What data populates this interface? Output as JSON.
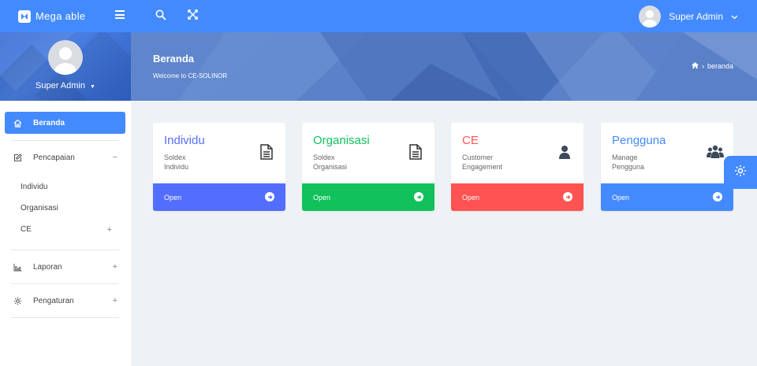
{
  "app": {
    "logo_text": "Mega able"
  },
  "topbar": {
    "user_name": "Super Admin"
  },
  "sidebar": {
    "user_name": "Super Admin",
    "items": [
      {
        "label": "Beranda",
        "icon": "home-icon",
        "active": true
      },
      {
        "label": "Pencapaian",
        "icon": "edit-icon",
        "toggle": "−"
      },
      {
        "label": "Laporan",
        "icon": "bar-chart-icon",
        "toggle": "+"
      },
      {
        "label": "Pengaturan",
        "icon": "gear-icon",
        "toggle": "+"
      }
    ],
    "sub_items": [
      {
        "label": "Individu"
      },
      {
        "label": "Organisasi"
      },
      {
        "label": "CE",
        "toggle": "+"
      }
    ]
  },
  "banner": {
    "title": "Beranda",
    "subtitle": "Welcome to CE-SOLINOR",
    "breadcrumb": "beranda"
  },
  "cards": [
    {
      "title": "Individu",
      "desc": "Soldex\nIndividu",
      "link": "Open",
      "color": "#536dfe",
      "title_color": "#536dfe",
      "icon": "document-icon"
    },
    {
      "title": "Organisasi",
      "desc": "Soldex\nOrganisasi",
      "link": "Open",
      "color": "#11c15b",
      "title_color": "#11c15b",
      "icon": "document-icon"
    },
    {
      "title": "CE",
      "desc": "Customer\nEngagement",
      "link": "Open",
      "color": "#ff5252",
      "title_color": "#ff5252",
      "icon": "user-icon"
    },
    {
      "title": "Pengguna",
      "desc": "Manage\nPengguna",
      "link": "Open",
      "color": "#448aff",
      "title_color": "#448aff",
      "icon": "users-icon"
    }
  ],
  "colors": {
    "primary": "#448aff",
    "background": "#eef2f5"
  }
}
